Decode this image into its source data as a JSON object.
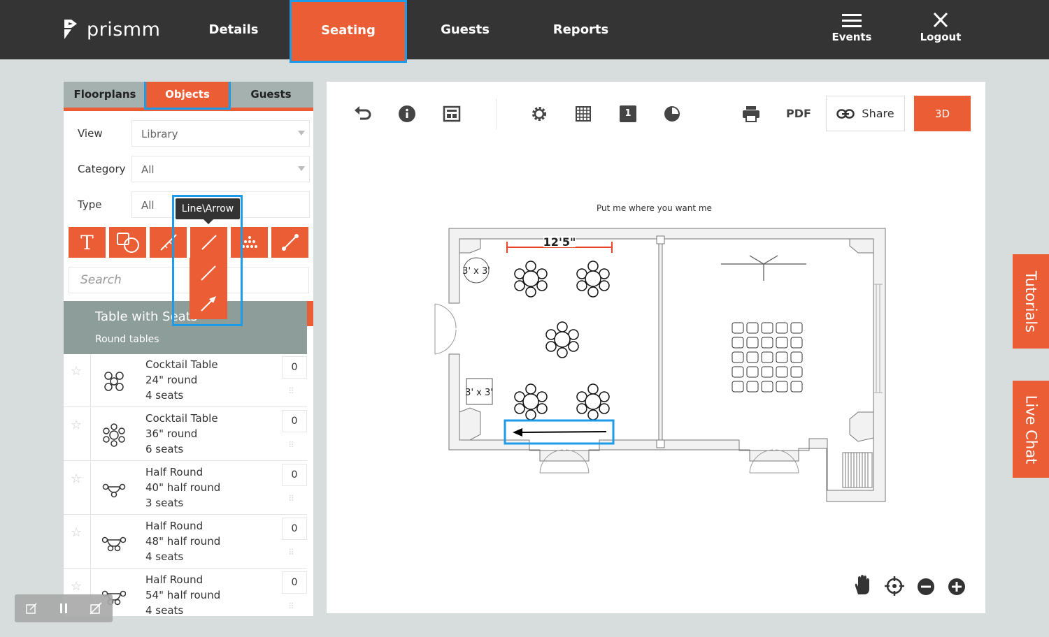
{
  "brand": {
    "name": "prismm"
  },
  "nav": {
    "items": [
      {
        "label": "Details"
      },
      {
        "label": "Seating"
      },
      {
        "label": "Guests"
      },
      {
        "label": "Reports"
      }
    ],
    "events_label": "Events",
    "logout_label": "Logout"
  },
  "panel": {
    "tabs": [
      {
        "label": "Floorplans"
      },
      {
        "label": "Objects"
      },
      {
        "label": "Guests"
      }
    ],
    "view": {
      "label": "View",
      "value": "Library"
    },
    "category": {
      "label": "Category",
      "value": "All"
    },
    "type": {
      "label": "Type",
      "value": "All"
    },
    "tooltip": "Line\\Arrow",
    "search_placeholder": "Search",
    "library": {
      "title": "Table with Seats",
      "subtitle": "Round tables"
    },
    "items": [
      {
        "name": "Cocktail Table",
        "size": "24\" round",
        "seats": "4 seats",
        "count": "0"
      },
      {
        "name": "Cocktail Table",
        "size": "36\" round",
        "seats": "6 seats",
        "count": "0"
      },
      {
        "name": "Half Round",
        "size": "40\" half round",
        "seats": "3 seats",
        "count": "0"
      },
      {
        "name": "Half Round",
        "size": "48\" half round",
        "seats": "4 seats",
        "count": "0"
      },
      {
        "name": "Half Round",
        "size": "54\" half round",
        "seats": "4 seats",
        "count": "0"
      }
    ]
  },
  "canvas": {
    "pdf_label": "PDF",
    "share_label": "Share",
    "btn_3d_label": "3D",
    "page_badge": "1",
    "hint": "Put me where you want me",
    "dimension_label": "12'5\"",
    "table_label_1": "3' x 3'",
    "table_label_2": "3' x 3'"
  },
  "side_tabs": {
    "tutorials": "Tutorials",
    "live_chat": "Live Chat"
  },
  "colors": {
    "accent": "#eb5d34",
    "topbar": "#343434",
    "highlight": "#1e9be8",
    "panel_header": "#8d9d9a"
  }
}
